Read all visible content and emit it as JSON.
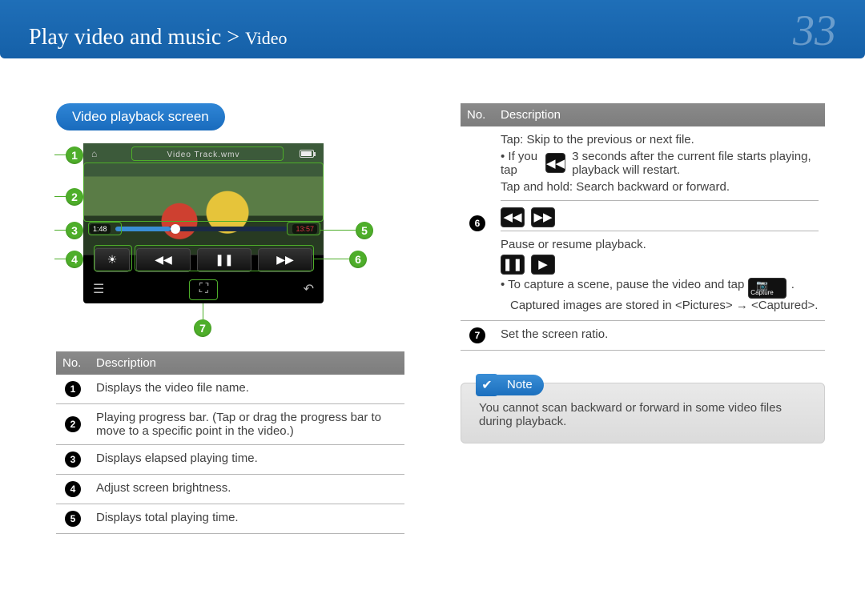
{
  "header": {
    "breadcrumb_main": "Play video and music",
    "breadcrumb_sep": ">",
    "breadcrumb_sub": "Video",
    "page_number": "33"
  },
  "left": {
    "section_title": "Video playback screen",
    "player": {
      "filename": "Video Track.wmv",
      "elapsed": "1:48",
      "total": "13:57"
    },
    "table": {
      "head_no": "No.",
      "head_desc": "Description",
      "rows": [
        {
          "n": "1",
          "desc": "Displays the video file name."
        },
        {
          "n": "2",
          "desc": "Playing progress bar. (Tap or drag the progress bar to move to a specific point in the video.)"
        },
        {
          "n": "3",
          "desc": "Displays elapsed playing time."
        },
        {
          "n": "4",
          "desc": "Adjust screen brightness."
        },
        {
          "n": "5",
          "desc": "Displays total playing time."
        }
      ]
    }
  },
  "right": {
    "table": {
      "head_no": "No.",
      "head_desc": "Description",
      "row6": {
        "n": "6",
        "line1": "Tap: Skip to the previous or next file.",
        "line2a": "• If you tap",
        "line2b": "3 seconds after the current file starts playing, playback will restart.",
        "line3": "Tap and hold: Search backward or forward.",
        "line4": "Pause or resume playback.",
        "line5a": "• To capture a scene, pause the video and tap",
        "line5b": ". Captured images are stored in <Pictures> → <Captured>.",
        "capture_label": "Capture"
      },
      "row7": {
        "n": "7",
        "desc": "Set the screen ratio."
      }
    },
    "note": {
      "label": "Note",
      "body": "You cannot scan backward or forward in some video files during playback."
    }
  }
}
